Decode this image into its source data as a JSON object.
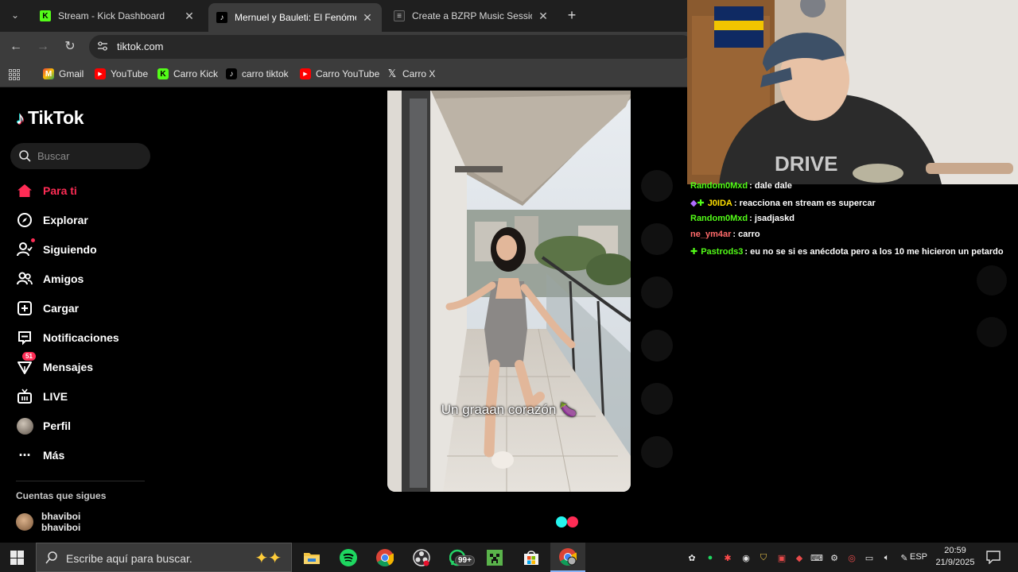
{
  "browser": {
    "tabs": [
      {
        "title": "Stream - Kick Dashboard",
        "active": false
      },
      {
        "title": "Mernuel y Bauleti: El Fenómeno",
        "active": true
      },
      {
        "title": "Create a BZRP Music Sessions T",
        "active": false
      }
    ],
    "url": "tiktok.com",
    "bookmarks": [
      "Gmail",
      "YouTube",
      "Carro Kick",
      "carro tiktok",
      "Carro YouTube",
      "Carro X"
    ]
  },
  "tiktok": {
    "logo_text": "TikTok",
    "search_placeholder": "Buscar",
    "nav": [
      {
        "label": "Para ti",
        "icon": "home-icon",
        "active": true
      },
      {
        "label": "Explorar",
        "icon": "compass-icon"
      },
      {
        "label": "Siguiendo",
        "icon": "following-icon"
      },
      {
        "label": "Amigos",
        "icon": "friends-icon"
      },
      {
        "label": "Cargar",
        "icon": "upload-icon"
      },
      {
        "label": "Notificaciones",
        "icon": "notifications-icon"
      },
      {
        "label": "Mensajes",
        "icon": "messages-icon",
        "badge": "51"
      },
      {
        "label": "LIVE",
        "icon": "live-icon"
      },
      {
        "label": "Perfil",
        "icon": "profile-avatar"
      },
      {
        "label": "Más",
        "icon": "more-icon"
      }
    ],
    "following_title": "Cuentas que sigues",
    "following_account": {
      "name": "bhaviboi",
      "handle": "bhaviboi"
    },
    "video_caption": "Un graaan corazón 🍆"
  },
  "chat": {
    "messages": [
      {
        "user": "Random0Mxd",
        "text": ": dale dale",
        "color": "#53fc18"
      },
      {
        "user": "J0IDA",
        "text": ": reacciona en stream es supercar",
        "color": "#ffe000",
        "badges": true
      },
      {
        "user": "Random0Mxd",
        "text": ": jsadjaskd",
        "color": "#53fc18"
      },
      {
        "user": "ne_ym4ar",
        "text": ": carro",
        "color": "#ff6a6a"
      },
      {
        "user": "Pastrods3",
        "text": ": eu no se si es anécdota pero a los 10 me hicieron un petardo",
        "color": "#53fc18",
        "badges": true
      }
    ]
  },
  "taskbar": {
    "search_placeholder": "Escribe aquí para buscar.",
    "whatsapp_badge": "99+",
    "language": "ESP",
    "time": "20:59",
    "date": "21/9/2025"
  },
  "colors": {
    "tiktok_red": "#fe2c55",
    "tiktok_cyan": "#25f4ee",
    "kick_green": "#53fc18"
  }
}
